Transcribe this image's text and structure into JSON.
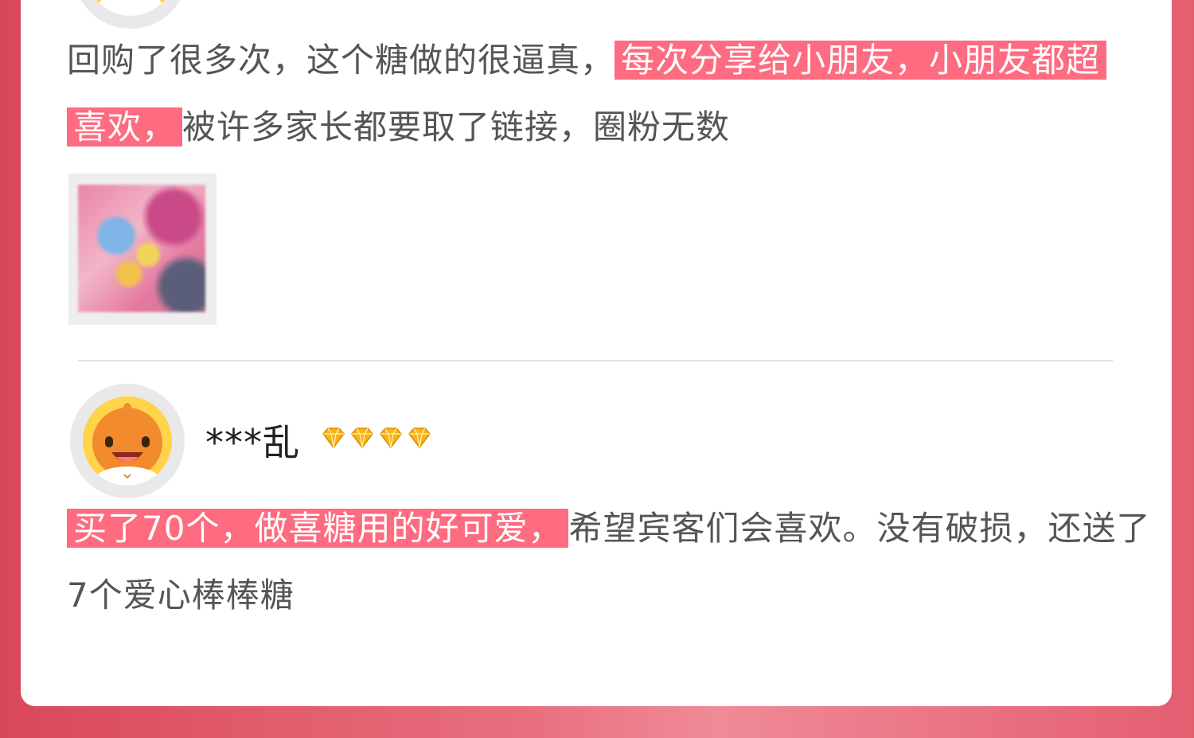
{
  "review_1": {
    "text_before": "回购了很多次，这个糖做的很逼真，",
    "highlight_1": "每次分享给小朋友，小朋友都超",
    "highlight_2": "喜欢，",
    "text_after": "被许多家长都要取了链接，圈粉无数",
    "avatar_icon": "mascot-avatar-icon",
    "photo_icon": "candy-photo-thumbnail"
  },
  "review_2": {
    "username": "***乱",
    "rating_icons": [
      "diamond-icon",
      "diamond-icon",
      "diamond-icon",
      "diamond-icon"
    ],
    "highlight": "买了70个，做喜糖用的好可爱，",
    "text_after": "希望宾客们会喜欢。没有破损，还送了7个爱心棒棒糖",
    "avatar_icon": "mascot-avatar-icon"
  },
  "colors": {
    "highlight_bg": "#ff6b80",
    "page_bg": "#e45e70",
    "card_bg": "#ffffff",
    "gem": "#f5b51a"
  }
}
